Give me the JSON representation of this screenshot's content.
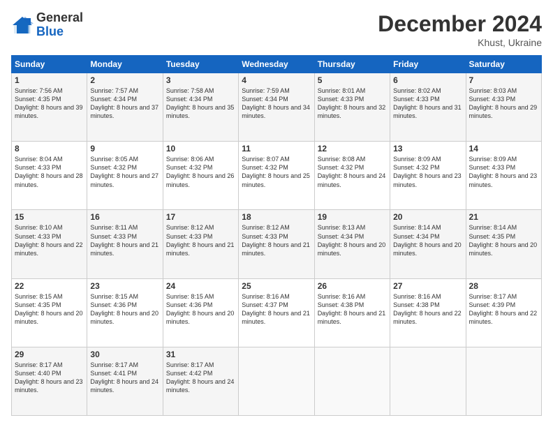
{
  "logo": {
    "general": "General",
    "blue": "Blue"
  },
  "header": {
    "month": "December 2024",
    "location": "Khust, Ukraine"
  },
  "days_of_week": [
    "Sunday",
    "Monday",
    "Tuesday",
    "Wednesday",
    "Thursday",
    "Friday",
    "Saturday"
  ],
  "weeks": [
    [
      {
        "day": "1",
        "sunrise": "7:56 AM",
        "sunset": "4:35 PM",
        "daylight": "8 hours and 39 minutes."
      },
      {
        "day": "2",
        "sunrise": "7:57 AM",
        "sunset": "4:34 PM",
        "daylight": "8 hours and 37 minutes."
      },
      {
        "day": "3",
        "sunrise": "7:58 AM",
        "sunset": "4:34 PM",
        "daylight": "8 hours and 35 minutes."
      },
      {
        "day": "4",
        "sunrise": "7:59 AM",
        "sunset": "4:34 PM",
        "daylight": "8 hours and 34 minutes."
      },
      {
        "day": "5",
        "sunrise": "8:01 AM",
        "sunset": "4:33 PM",
        "daylight": "8 hours and 32 minutes."
      },
      {
        "day": "6",
        "sunrise": "8:02 AM",
        "sunset": "4:33 PM",
        "daylight": "8 hours and 31 minutes."
      },
      {
        "day": "7",
        "sunrise": "8:03 AM",
        "sunset": "4:33 PM",
        "daylight": "8 hours and 29 minutes."
      }
    ],
    [
      {
        "day": "8",
        "sunrise": "8:04 AM",
        "sunset": "4:33 PM",
        "daylight": "8 hours and 28 minutes."
      },
      {
        "day": "9",
        "sunrise": "8:05 AM",
        "sunset": "4:32 PM",
        "daylight": "8 hours and 27 minutes."
      },
      {
        "day": "10",
        "sunrise": "8:06 AM",
        "sunset": "4:32 PM",
        "daylight": "8 hours and 26 minutes."
      },
      {
        "day": "11",
        "sunrise": "8:07 AM",
        "sunset": "4:32 PM",
        "daylight": "8 hours and 25 minutes."
      },
      {
        "day": "12",
        "sunrise": "8:08 AM",
        "sunset": "4:32 PM",
        "daylight": "8 hours and 24 minutes."
      },
      {
        "day": "13",
        "sunrise": "8:09 AM",
        "sunset": "4:32 PM",
        "daylight": "8 hours and 23 minutes."
      },
      {
        "day": "14",
        "sunrise": "8:09 AM",
        "sunset": "4:33 PM",
        "daylight": "8 hours and 23 minutes."
      }
    ],
    [
      {
        "day": "15",
        "sunrise": "8:10 AM",
        "sunset": "4:33 PM",
        "daylight": "8 hours and 22 minutes."
      },
      {
        "day": "16",
        "sunrise": "8:11 AM",
        "sunset": "4:33 PM",
        "daylight": "8 hours and 21 minutes."
      },
      {
        "day": "17",
        "sunrise": "8:12 AM",
        "sunset": "4:33 PM",
        "daylight": "8 hours and 21 minutes."
      },
      {
        "day": "18",
        "sunrise": "8:12 AM",
        "sunset": "4:33 PM",
        "daylight": "8 hours and 21 minutes."
      },
      {
        "day": "19",
        "sunrise": "8:13 AM",
        "sunset": "4:34 PM",
        "daylight": "8 hours and 20 minutes."
      },
      {
        "day": "20",
        "sunrise": "8:14 AM",
        "sunset": "4:34 PM",
        "daylight": "8 hours and 20 minutes."
      },
      {
        "day": "21",
        "sunrise": "8:14 AM",
        "sunset": "4:35 PM",
        "daylight": "8 hours and 20 minutes."
      }
    ],
    [
      {
        "day": "22",
        "sunrise": "8:15 AM",
        "sunset": "4:35 PM",
        "daylight": "8 hours and 20 minutes."
      },
      {
        "day": "23",
        "sunrise": "8:15 AM",
        "sunset": "4:36 PM",
        "daylight": "8 hours and 20 minutes."
      },
      {
        "day": "24",
        "sunrise": "8:15 AM",
        "sunset": "4:36 PM",
        "daylight": "8 hours and 20 minutes."
      },
      {
        "day": "25",
        "sunrise": "8:16 AM",
        "sunset": "4:37 PM",
        "daylight": "8 hours and 21 minutes."
      },
      {
        "day": "26",
        "sunrise": "8:16 AM",
        "sunset": "4:38 PM",
        "daylight": "8 hours and 21 minutes."
      },
      {
        "day": "27",
        "sunrise": "8:16 AM",
        "sunset": "4:38 PM",
        "daylight": "8 hours and 22 minutes."
      },
      {
        "day": "28",
        "sunrise": "8:17 AM",
        "sunset": "4:39 PM",
        "daylight": "8 hours and 22 minutes."
      }
    ],
    [
      {
        "day": "29",
        "sunrise": "8:17 AM",
        "sunset": "4:40 PM",
        "daylight": "8 hours and 23 minutes."
      },
      {
        "day": "30",
        "sunrise": "8:17 AM",
        "sunset": "4:41 PM",
        "daylight": "8 hours and 24 minutes."
      },
      {
        "day": "31",
        "sunrise": "8:17 AM",
        "sunset": "4:42 PM",
        "daylight": "8 hours and 24 minutes."
      },
      null,
      null,
      null,
      null
    ]
  ],
  "labels": {
    "sunrise": "Sunrise:",
    "sunset": "Sunset:",
    "daylight": "Daylight:"
  }
}
